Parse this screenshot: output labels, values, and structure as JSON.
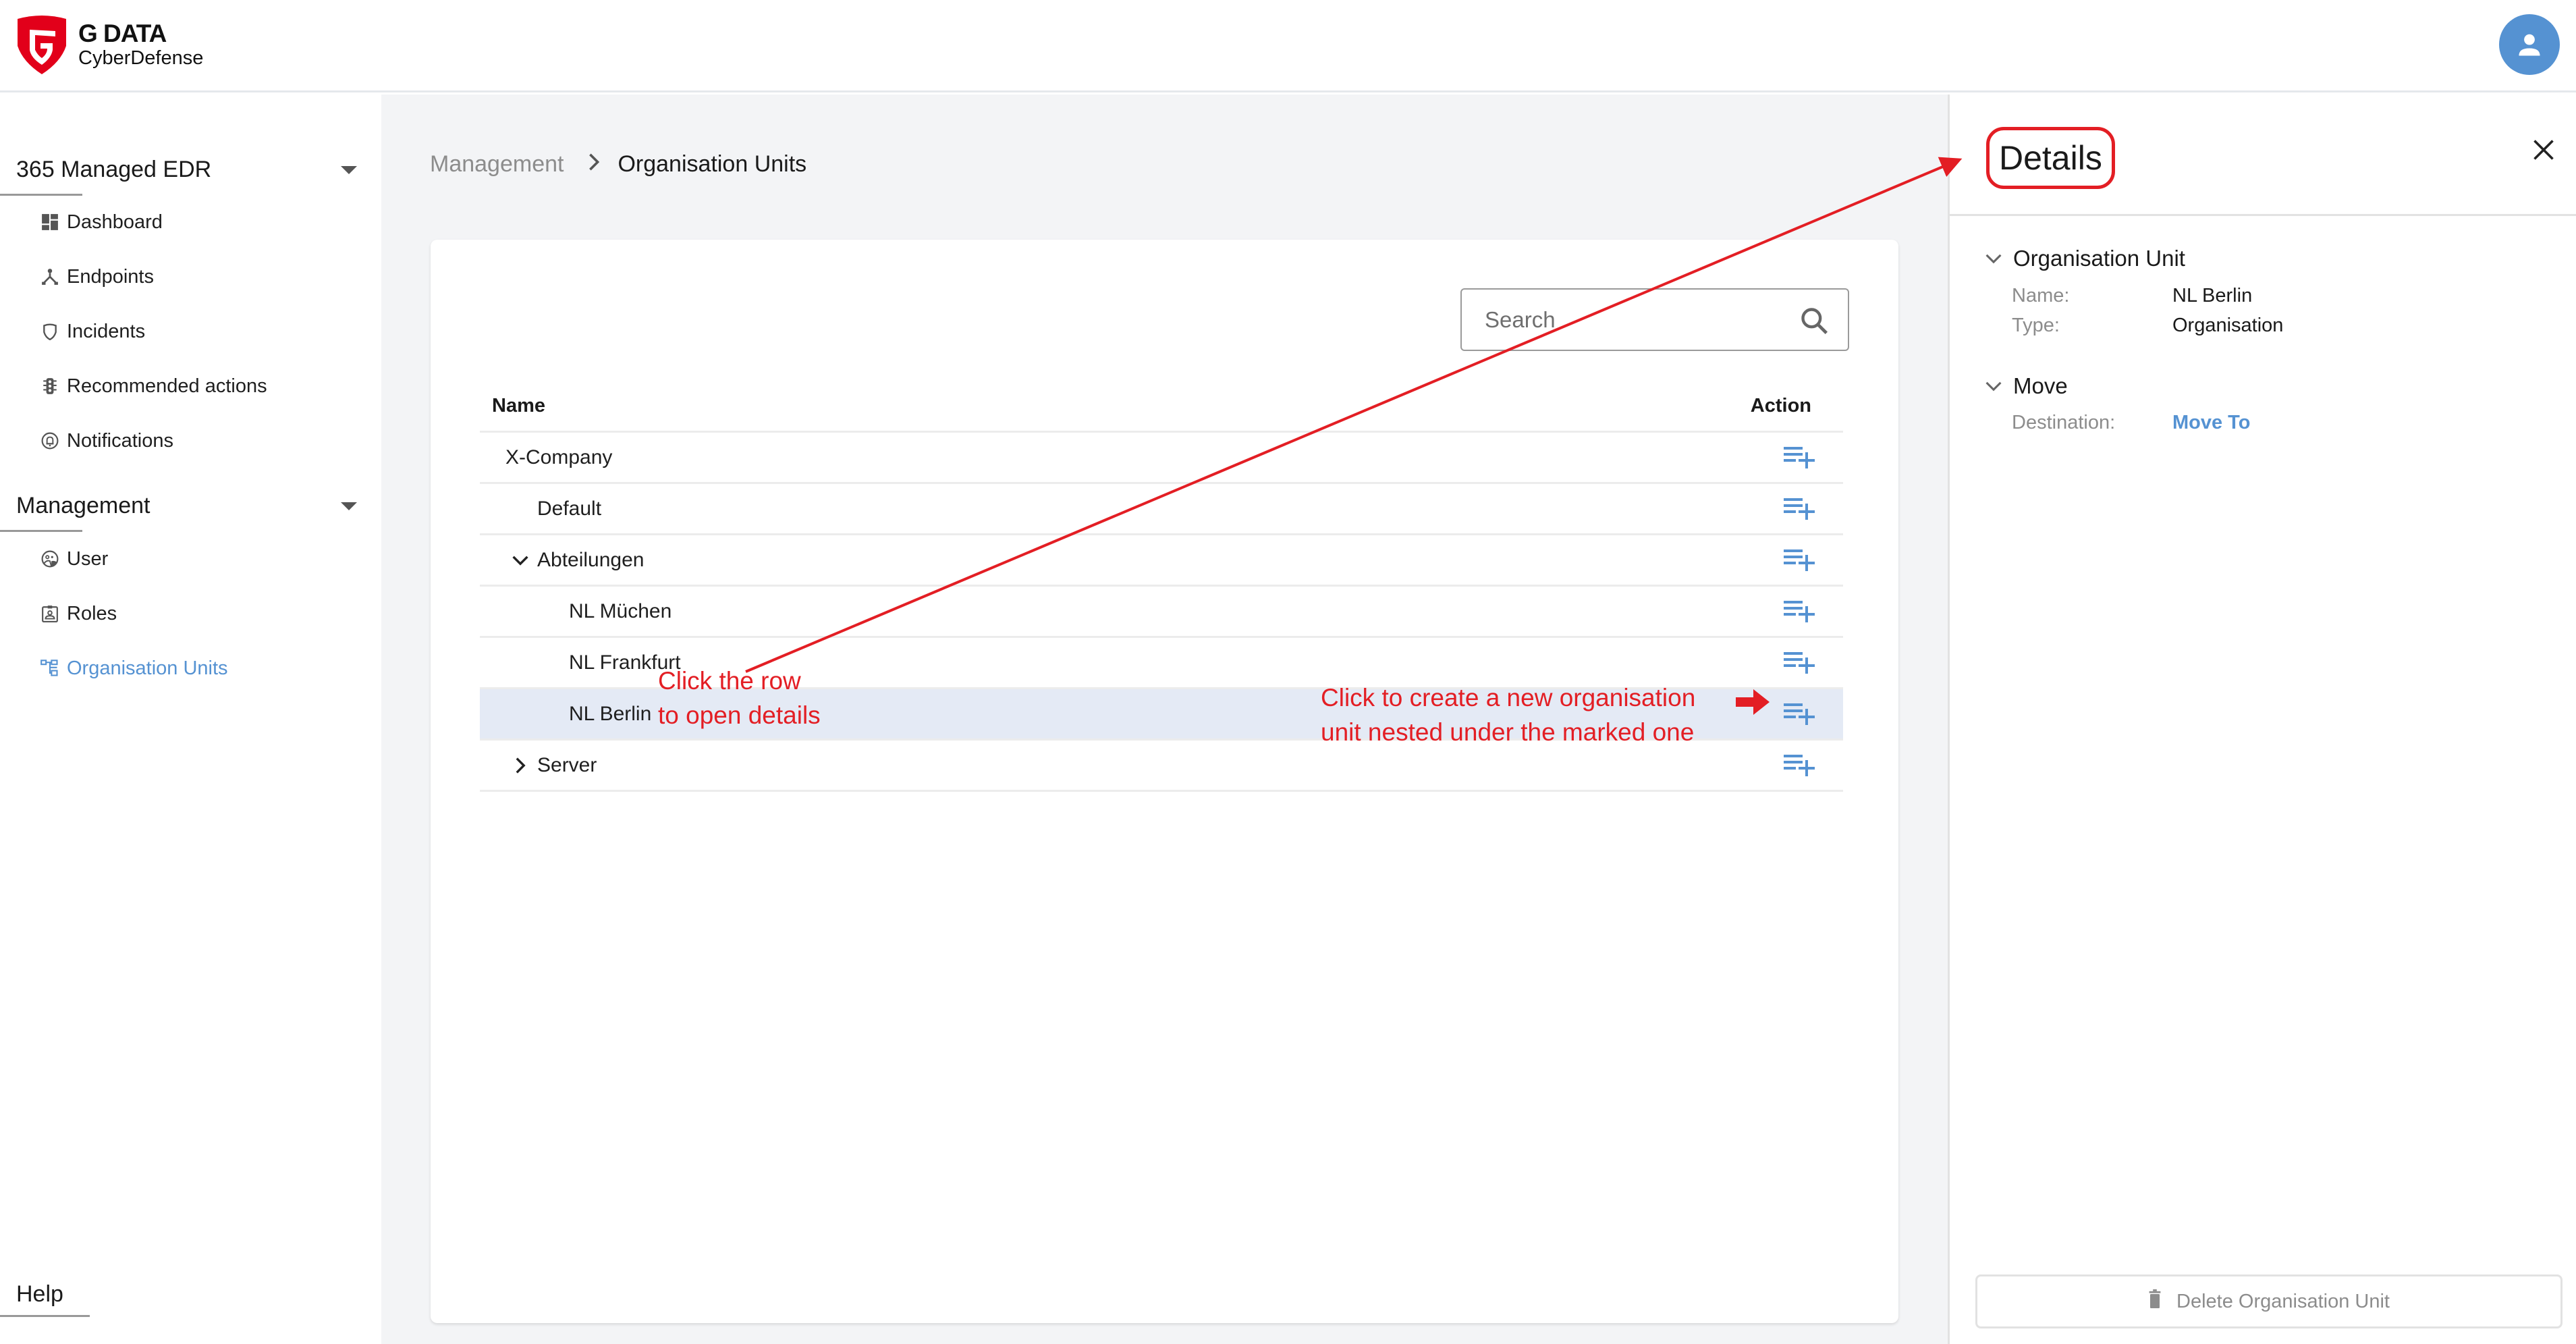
{
  "header": {
    "logo_brand": "G DATA",
    "logo_sub": "CyberDefense",
    "avatar_icon": "user-avatar-icon",
    "accent_color": "#5592d2",
    "brand_color": "#e2001a"
  },
  "sidebar": {
    "groups": [
      {
        "title": "365 Managed EDR",
        "items": [
          {
            "label": "Dashboard",
            "icon": "dashboard-icon"
          },
          {
            "label": "Endpoints",
            "icon": "endpoints-icon"
          },
          {
            "label": "Incidents",
            "icon": "shield-icon"
          },
          {
            "label": "Recommended actions",
            "icon": "traffic-light-icon"
          },
          {
            "label": "Notifications",
            "icon": "bell-icon"
          }
        ]
      },
      {
        "title": "Management",
        "items": [
          {
            "label": "User",
            "icon": "user-icon"
          },
          {
            "label": "Roles",
            "icon": "badge-icon"
          },
          {
            "label": "Organisation Units",
            "icon": "org-tree-icon",
            "active": true
          }
        ]
      }
    ],
    "help_label": "Help"
  },
  "breadcrumb": {
    "parent": "Management",
    "separator": "›",
    "current": "Organisation Units"
  },
  "search": {
    "placeholder": "Search",
    "value": ""
  },
  "table": {
    "columns": {
      "name": "Name",
      "action": "Action"
    },
    "rows": [
      {
        "name": "X-Company",
        "level": 0,
        "expander": "none",
        "selected": false
      },
      {
        "name": "Default",
        "level": 1,
        "expander": "none",
        "selected": false
      },
      {
        "name": "Abteilungen",
        "level": 1,
        "expander": "expanded",
        "selected": false
      },
      {
        "name": "NL Müchen",
        "level": 2,
        "expander": "none",
        "selected": false
      },
      {
        "name": "NL Frankfurt",
        "level": 2,
        "expander": "none",
        "selected": false
      },
      {
        "name": "NL Berlin",
        "level": 2,
        "expander": "none",
        "selected": true
      },
      {
        "name": "Server",
        "level": 1,
        "expander": "collapsed",
        "selected": false
      }
    ],
    "action_icon": "add-child-list-icon"
  },
  "details": {
    "title": "Details",
    "sections": [
      {
        "title": "Organisation Unit",
        "fields": [
          {
            "label": "Name:",
            "value": "NL Berlin"
          },
          {
            "label": "Type:",
            "value": "Organisation"
          }
        ]
      },
      {
        "title": "Move",
        "fields": [
          {
            "label": "Destination:",
            "value": "Move To",
            "link": true
          }
        ]
      }
    ],
    "delete_label": "Delete Organisation Unit"
  },
  "annotations": {
    "row_hint_line1": "Click the row",
    "row_hint_line2": "to open details",
    "action_hint_line1": "Click to create a new organisation",
    "action_hint_line2": "unit nested under the marked one",
    "color": "#e31e24"
  }
}
